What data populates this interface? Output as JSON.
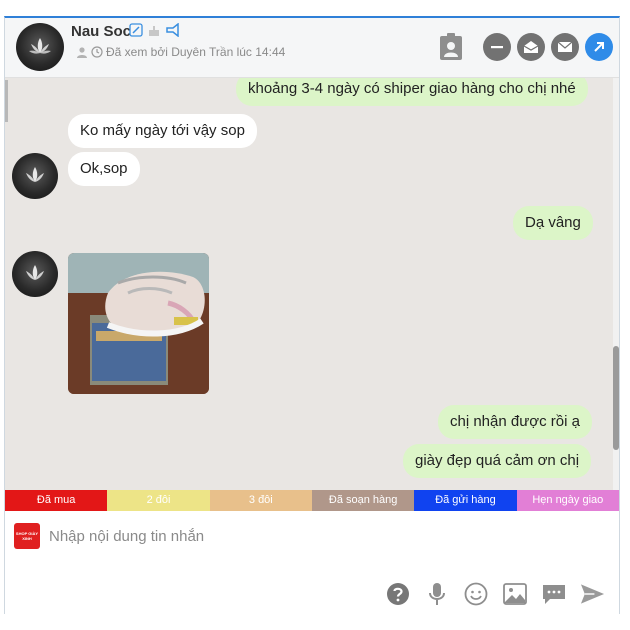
{
  "header": {
    "contact_name": "Nau Soc",
    "seen_text": "Đã xem bởi Duyên Trần lúc 14:44"
  },
  "messages": [
    {
      "direction": "out",
      "text": "khoảng 3-4 ngày có shiper giao hàng cho chị nhé"
    },
    {
      "direction": "in",
      "text": "Ko mấy ngày tới vậy sop"
    },
    {
      "direction": "in",
      "text": "Ok,sop"
    },
    {
      "direction": "out",
      "text": "Dạ vâng"
    },
    {
      "direction": "in",
      "type": "image",
      "alt": "photo of sneakers"
    },
    {
      "direction": "out",
      "text": "chị nhận được rồi ạ"
    },
    {
      "direction": "out",
      "text": "giày đẹp quá cảm ơn chị"
    }
  ],
  "status_tags": [
    {
      "label": "Đã mua",
      "color": "#e31717"
    },
    {
      "label": "2 đôi",
      "color": "#ede487"
    },
    {
      "label": "3 đôi",
      "color": "#e8c08b"
    },
    {
      "label": "Đã soạn hàng",
      "color": "#b0978a"
    },
    {
      "label": "Đã gửi hàng",
      "color": "#1043f0"
    },
    {
      "label": "Hẹn ngày giao",
      "color": "#e27fd6"
    }
  ],
  "composer": {
    "placeholder": "Nhập nội dung tin nhắn",
    "shop_logo_text": "SHOP GIÀY XINH"
  },
  "icons": [
    "camera-icon",
    "bell-icon",
    "message-square-icon",
    "user-icon",
    "clock-icon",
    "contact-card-icon",
    "minus-icon",
    "mail-icon",
    "envelope-icon",
    "arrow-up-right-icon",
    "help-icon",
    "microphone-icon",
    "smile-icon",
    "image-icon",
    "comment-icon",
    "send-icon"
  ],
  "colors": {
    "accent": "#2f8be8",
    "outgoing_bubble": "#dcf5c8",
    "chat_background": "#e9e6e3"
  }
}
